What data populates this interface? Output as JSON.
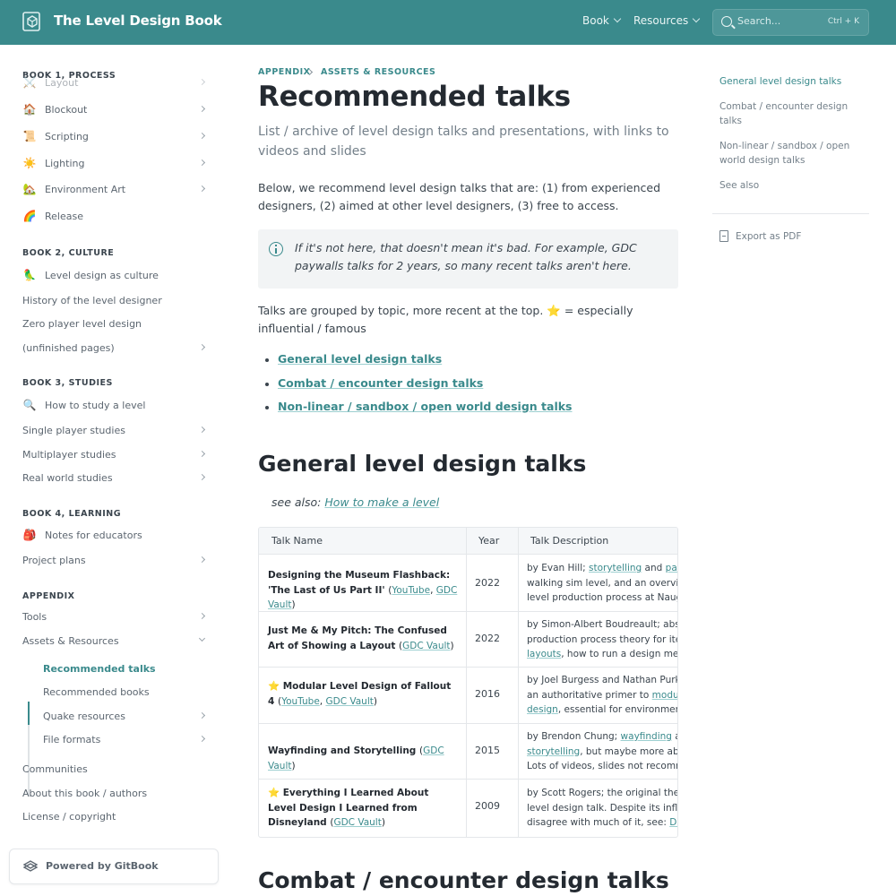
{
  "header": {
    "brand": "The Level Design Book",
    "nav": [
      {
        "label": "Book"
      },
      {
        "label": "Resources"
      }
    ],
    "search": {
      "placeholder": "Search...",
      "shortcut": "Ctrl + K"
    }
  },
  "sidebar": {
    "book1": {
      "heading": "BOOK 1, PROCESS",
      "items": [
        {
          "icon": "⚔️",
          "icon_name": "crossed-swords-icon",
          "label": "Layout"
        },
        {
          "icon": "🏠",
          "icon_name": "house-icon",
          "label": "Blockout"
        },
        {
          "icon": "📜",
          "icon_name": "scroll-icon",
          "label": "Scripting"
        },
        {
          "icon": "☀️",
          "icon_name": "sun-icon",
          "label": "Lighting"
        },
        {
          "icon": "🏡",
          "icon_name": "house-garden-icon",
          "label": "Environment Art"
        },
        {
          "icon": "🌈",
          "icon_name": "rainbow-icon",
          "label": "Release"
        }
      ]
    },
    "book2": {
      "heading": "BOOK 2, CULTURE",
      "items": [
        {
          "icon": "🦜",
          "icon_name": "parrot-icon",
          "label": "Level design as culture"
        },
        {
          "label": "History of the level designer"
        },
        {
          "label": "Zero player level design"
        },
        {
          "label": "(unfinished pages)"
        }
      ]
    },
    "book3": {
      "heading": "BOOK 3, STUDIES",
      "items": [
        {
          "icon": "🔍",
          "icon_name": "magnifier-icon",
          "label": "How to study a level"
        },
        {
          "label": "Single player studies"
        },
        {
          "label": "Multiplayer studies"
        },
        {
          "label": "Real world studies"
        }
      ]
    },
    "book4": {
      "heading": "BOOK 4, LEARNING",
      "items": [
        {
          "icon": "🎒",
          "icon_name": "backpack-icon",
          "label": "Notes for educators"
        },
        {
          "label": "Project plans"
        }
      ]
    },
    "appendix": {
      "heading": "APPENDIX",
      "items": [
        {
          "label": "Tools"
        },
        {
          "label": "Assets & Resources"
        },
        {
          "label": "Recommended talks"
        },
        {
          "label": "Recommended books"
        },
        {
          "label": "Quake resources"
        },
        {
          "label": "File formats"
        },
        {
          "label": "Communities"
        },
        {
          "label": "About this book / authors"
        },
        {
          "label": "License / copyright"
        }
      ]
    },
    "powered_by": "Powered by GitBook"
  },
  "main": {
    "breadcrumb": [
      "APPENDIX",
      "ASSETS & RESOURCES"
    ],
    "title": "Recommended talks",
    "lead": "List / archive of level design talks and presentations, with links to videos and slides",
    "intro": "Below, we recommend level design talks that are: (1) from experienced designers, (2) aimed at other level designers, (3) free to access.",
    "hint": "If it's not here, that doesn't mean it's bad. For example, GDC paywalls talks for 2 years, so many recent talks aren't here.",
    "grouping": "Talks are grouped by topic, more recent at the top. ⭐ = especially influential / famous",
    "toc": [
      "General level design talks",
      "Combat / encounter design talks",
      "Non-linear / sandbox / open world design talks"
    ],
    "section1": "General level design talks",
    "see_also_prefix": "see also: ",
    "see_also_link": "How to make a level",
    "table": {
      "headers": [
        "Talk Name",
        "Year",
        "Talk Description"
      ],
      "rows": [
        {
          "name": "Designing the Museum Flashback: 'The Last of Us Part II'",
          "links": [
            "YouTube",
            "GDC Vault"
          ],
          "year": "2022",
          "desc": [
            "by Evan Hill; ",
            "storytelling",
            " and ",
            "pacin",
            "walking sim level, and an overview",
            "level production process at Naught"
          ]
        },
        {
          "name": "Just Me & My Pitch: The Confused Art of Showing a Layout",
          "links": [
            "GDC Vault"
          ],
          "year": "2022",
          "desc": [
            "by Simon-Albert Boudreault; abstra",
            "production process theory for itera",
            "layouts",
            ", how to run a design meetin"
          ]
        },
        {
          "name": "⭐ Modular Level Design of Fallout 4",
          "links": [
            "YouTube",
            "GDC Vault"
          ],
          "year": "2016",
          "desc": [
            "by Joel Burgess and Nathan Purkey",
            "an authoritative primer to ",
            "modular",
            "design",
            ", essential for environment a"
          ]
        },
        {
          "name": "Wayfinding and Storytelling",
          "links": [
            "GDC Vault"
          ],
          "year": "2015",
          "desc": [
            "by Brendon Chung; ",
            "wayfinding",
            " and",
            "storytelling",
            ", but maybe more abou",
            "Lots of videos, slides not recomme"
          ]
        },
        {
          "name": "⭐ Everything I Learned About Level Design I Learned from Disneyland",
          "links": [
            "GDC Vault"
          ],
          "year": "2009",
          "desc": [
            "by Scott Rogers; the original theme",
            "level design talk. Despite its influer",
            "disagree with much of it, see: ",
            "Disne"
          ]
        }
      ]
    },
    "section2": "Combat / encounter design talks"
  },
  "right_toc": {
    "items": [
      "General level design talks",
      "Combat / encounter design talks",
      "Non-linear / sandbox / open world design talks",
      "See also"
    ],
    "export": "Export as PDF"
  },
  "colors": {
    "accent": "#3a8a8c",
    "header_bg": "#3a8a8c",
    "text": "#3b454e",
    "heading": "#242a31"
  }
}
